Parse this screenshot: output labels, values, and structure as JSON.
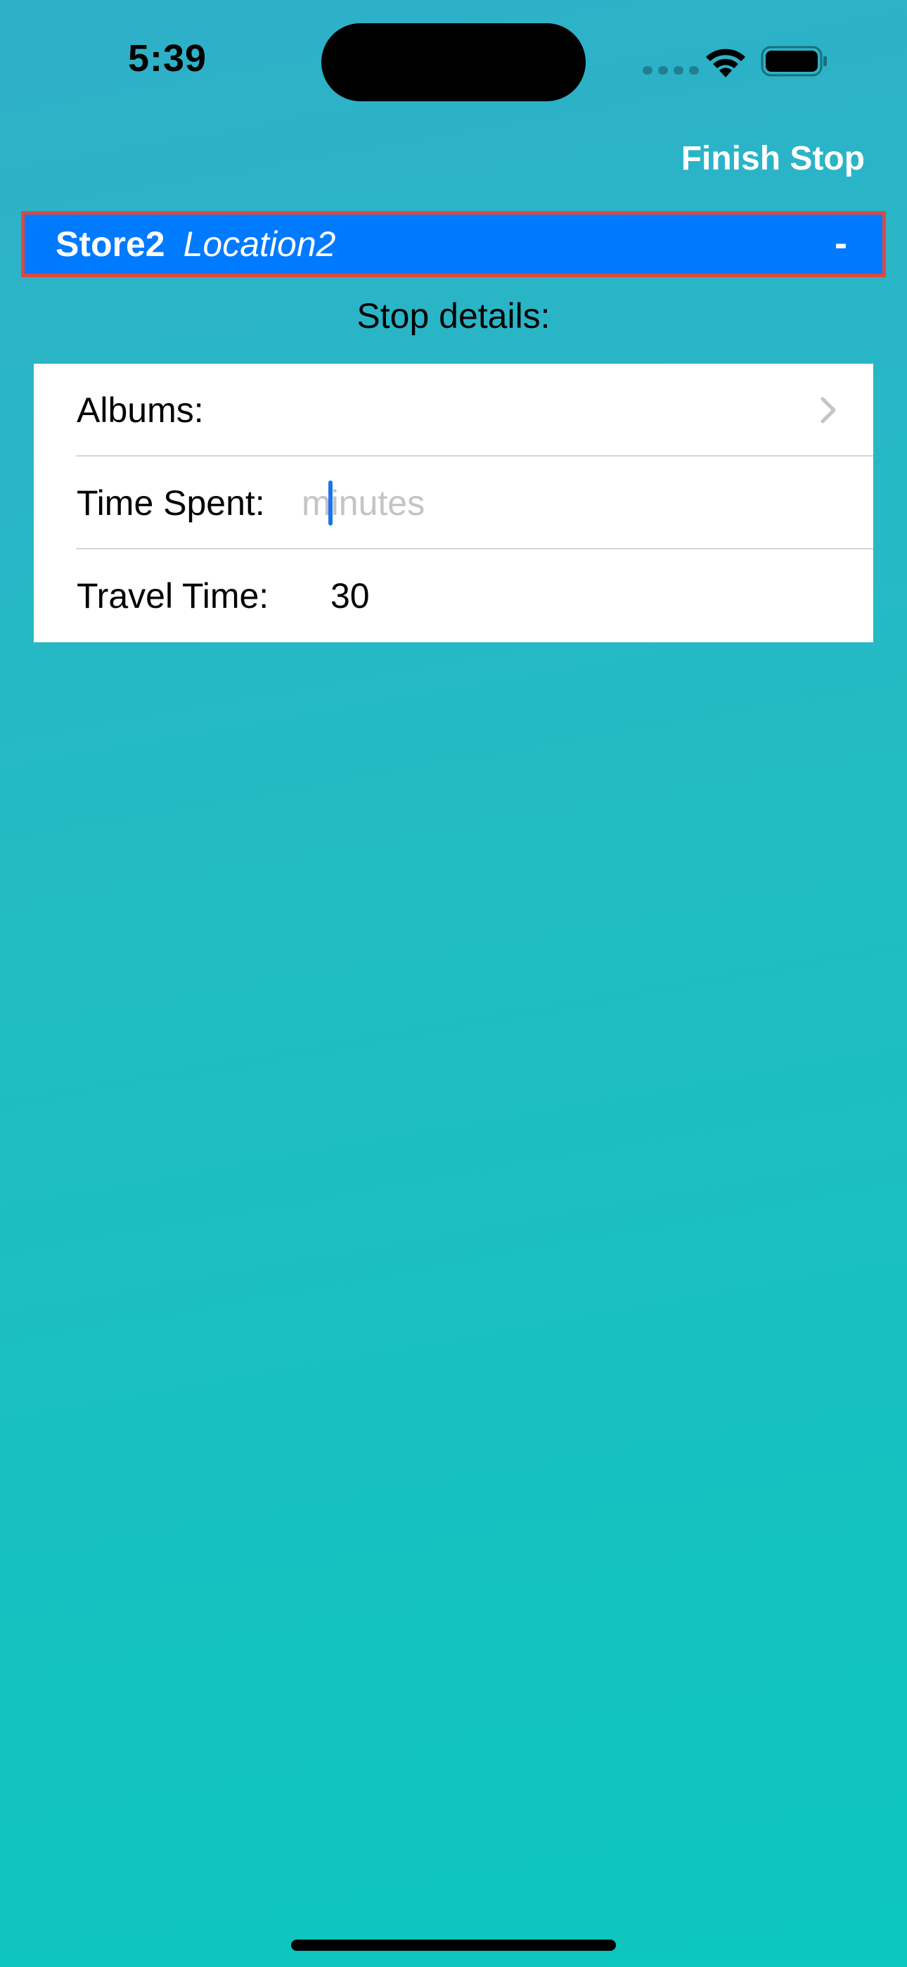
{
  "status_bar": {
    "time": "5:39",
    "icons": [
      "cellular-icon",
      "wifi-icon",
      "battery-icon"
    ]
  },
  "nav": {
    "finish_button_label": "Finish Stop"
  },
  "stop": {
    "name": "Store2",
    "location": "Location2",
    "remove_label": "-"
  },
  "details": {
    "section_title": "Stop details:",
    "albums_label": "Albums:",
    "time_spent_label": "Time Spent:",
    "time_spent_value": "",
    "time_spent_placeholder": "minutes",
    "travel_time_label": "Travel Time:",
    "travel_time_value": "30"
  },
  "colors": {
    "accent": "#007aff",
    "selection_border": "#e0473f",
    "background_top": "#2fb0c8",
    "background_bottom": "#0cc6be"
  }
}
